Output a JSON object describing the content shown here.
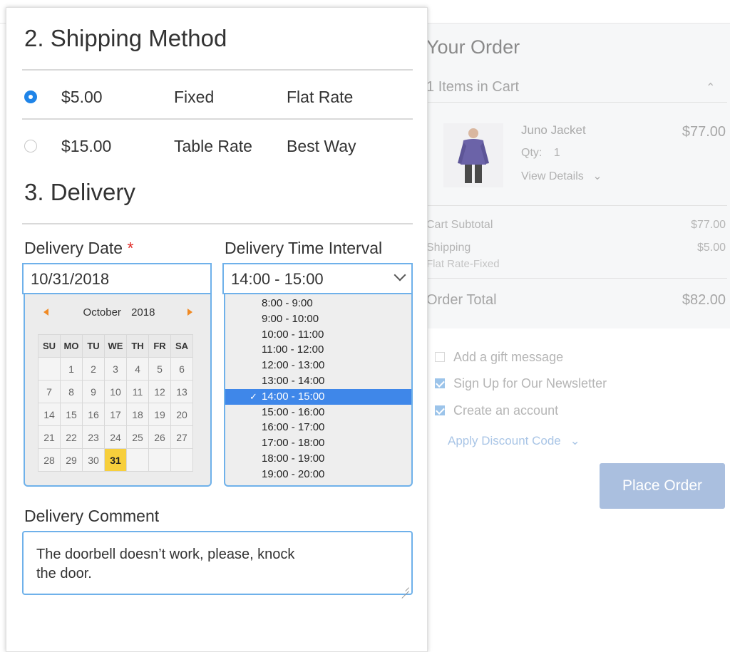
{
  "shipping": {
    "title": "2. Shipping Method",
    "options": [
      {
        "price": "$5.00",
        "method": "Fixed",
        "carrier": "Flat Rate",
        "selected": true
      },
      {
        "price": "$15.00",
        "method": "Table Rate",
        "carrier": "Best Way",
        "selected": false
      }
    ]
  },
  "delivery": {
    "title": "3. Delivery",
    "date_label": "Delivery Date",
    "required_mark": "*",
    "date_value": "10/31/2018",
    "time_label": "Delivery Time Interval",
    "time_value": "14:00 - 15:00",
    "calendar": {
      "month": "October",
      "year": "2018",
      "weekdays": [
        "SU",
        "MO",
        "TU",
        "WE",
        "TH",
        "FR",
        "SA"
      ],
      "weeks": [
        [
          "",
          "1",
          "2",
          "3",
          "4",
          "5",
          "6"
        ],
        [
          "7",
          "8",
          "9",
          "10",
          "11",
          "12",
          "13"
        ],
        [
          "14",
          "15",
          "16",
          "17",
          "18",
          "19",
          "20"
        ],
        [
          "21",
          "22",
          "23",
          "24",
          "25",
          "26",
          "27"
        ],
        [
          "28",
          "29",
          "30",
          "31",
          "",
          "",
          ""
        ]
      ],
      "selected_day": "31"
    },
    "time_options": [
      "8:00 - 9:00",
      "9:00 - 10:00",
      "10:00 - 11:00",
      "11:00 - 12:00",
      "12:00 - 13:00",
      "13:00 - 14:00",
      "14:00 - 15:00",
      "15:00 - 16:00",
      "16:00 - 17:00",
      "17:00 - 18:00",
      "18:00 - 19:00",
      "19:00 - 20:00"
    ],
    "selected_time": "14:00 - 15:00",
    "comment_label": "Delivery Comment",
    "comment_line1": "The doorbell doesn’t work, please, knock",
    "comment_line2": "the door."
  },
  "order": {
    "title": "Your Order",
    "items_in_cart": "Items in Cart",
    "product": {
      "name": "Juno Jacket",
      "qty_label": "Qty:",
      "qty": "1",
      "details": "View Details",
      "price": "$77.00"
    },
    "subtotal_label": "Cart Subtotal",
    "subtotal_value": "$77.00",
    "shipping_label": "Shipping",
    "shipping_value": "$5.00",
    "shipping_sub": "Flat Rate-Fixed",
    "total_label": "Order Total",
    "total_value": "$82.00",
    "gift_message": "Add a gift message",
    "newsletter": "Sign Up for Our Newsletter",
    "create_account": "Create an account",
    "discount": "Apply Discount Code",
    "place_order": "Place Order"
  },
  "colors": {
    "accent": "#1f84e8",
    "focus_border": "#6fb1ea",
    "calendar_selected": "#f7cf3c",
    "arrow": "#f08a24",
    "selected_option": "#3f87e9"
  }
}
